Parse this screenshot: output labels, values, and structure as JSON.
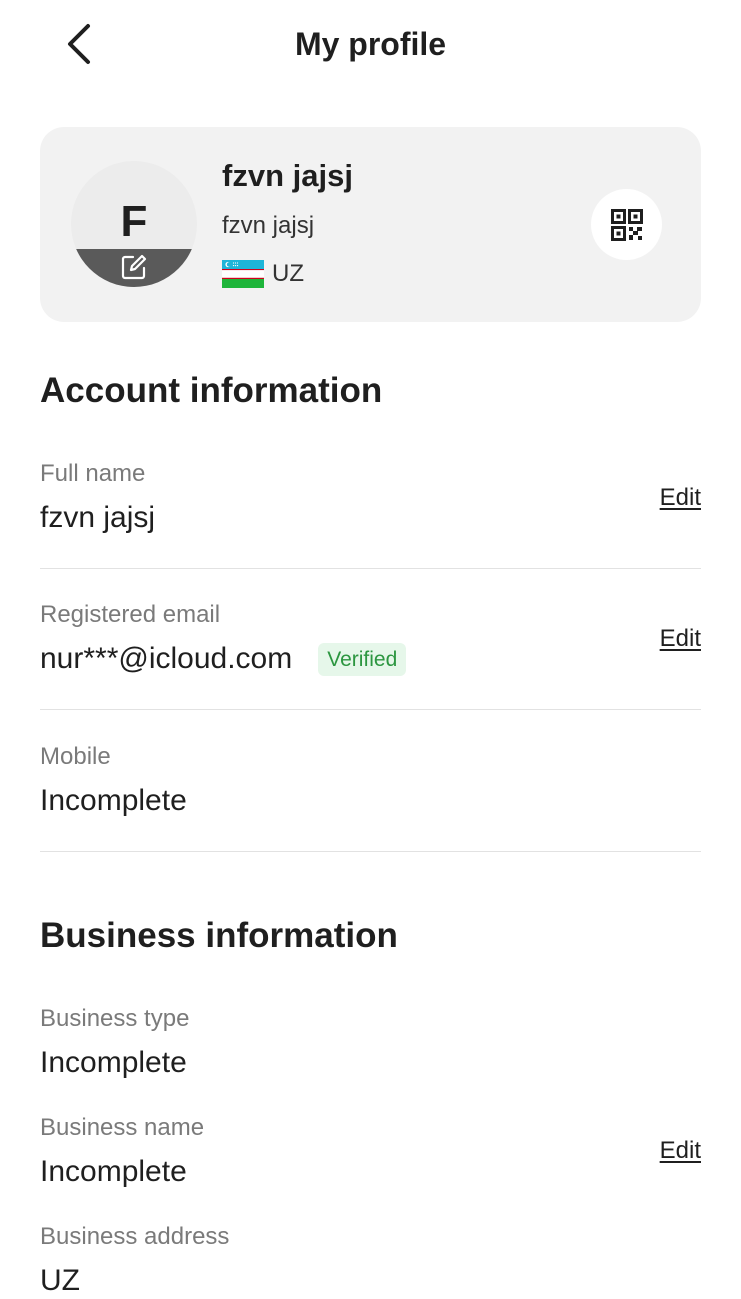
{
  "header": {
    "title": "My profile",
    "back_icon": "chevron-left-icon"
  },
  "profile": {
    "initial": "F",
    "name": "fzvn jajsj",
    "username": "fzvn jajsj",
    "country_code": "UZ",
    "flag_icon": "uzbekistan-flag-icon",
    "avatar_edit_icon": "edit-icon",
    "qr_icon": "qr-code-icon"
  },
  "account": {
    "title": "Account information",
    "full_name": {
      "label": "Full name",
      "value": "fzvn jajsj",
      "action": "Edit"
    },
    "email": {
      "label": "Registered email",
      "value": "nur***@icloud.com",
      "badge": "Verified",
      "action": "Edit"
    },
    "mobile": {
      "label": "Mobile",
      "value": "Incomplete"
    }
  },
  "business": {
    "title": "Business information",
    "type": {
      "label": "Business type",
      "value": "Incomplete"
    },
    "name": {
      "label": "Business name",
      "value": "Incomplete",
      "action": "Edit"
    },
    "address": {
      "label": "Business address",
      "value": "UZ"
    }
  },
  "colors": {
    "card_bg": "#f2f2f2",
    "verified_text": "#2c9640",
    "verified_bg": "#e6f7ea",
    "label_gray": "#7a7a7a"
  }
}
